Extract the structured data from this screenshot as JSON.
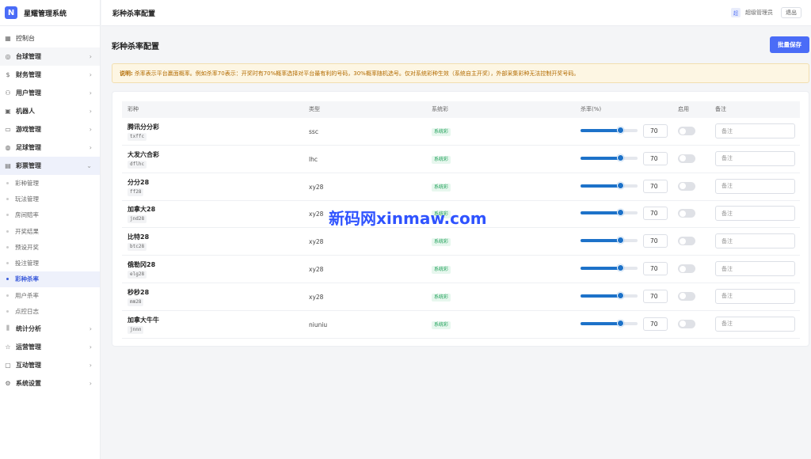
{
  "app": {
    "logo": "N",
    "name": "星耀管理系统"
  },
  "topbar": {
    "title": "彩种杀率配置",
    "user_badge": "超",
    "user_name": "超级管理员",
    "logout_label": "退出"
  },
  "sidebar": {
    "items": [
      {
        "label": "控制台",
        "icon": "dashboard-icon",
        "glyph": "▦",
        "bold": false,
        "chevron": ""
      },
      {
        "label": "台球管理",
        "icon": "billiards-icon",
        "glyph": "◎",
        "bold": true,
        "chevron": "›"
      },
      {
        "label": "财务管理",
        "icon": "dollar-icon",
        "glyph": "$",
        "bold": true,
        "chevron": "›"
      },
      {
        "label": "用户管理",
        "icon": "users-icon",
        "glyph": "⚇",
        "bold": true,
        "chevron": "›"
      },
      {
        "label": "机器人",
        "icon": "robot-icon",
        "glyph": "▣",
        "bold": true,
        "chevron": "›"
      },
      {
        "label": "游戏管理",
        "icon": "gamepad-icon",
        "glyph": "▭",
        "bold": true,
        "chevron": "›"
      },
      {
        "label": "足球管理",
        "icon": "football-icon",
        "glyph": "◍",
        "bold": true,
        "chevron": "›"
      },
      {
        "label": "彩票管理",
        "icon": "lottery-icon",
        "glyph": "▤",
        "bold": true,
        "chevron": "⌄"
      }
    ],
    "sub_items": [
      "彩种管理",
      "玩法管理",
      "房间赔率",
      "开奖结果",
      "预设开奖",
      "投注管理",
      "彩种杀率",
      "用户杀率",
      "点控日志"
    ],
    "active_sub": "彩种杀率",
    "items_after": [
      {
        "label": "统计分析",
        "icon": "bar-chart-icon",
        "glyph": "⫼",
        "bold": true,
        "chevron": "›"
      },
      {
        "label": "运营管理",
        "icon": "star-icon",
        "glyph": "☆",
        "bold": true,
        "chevron": "›"
      },
      {
        "label": "互动管理",
        "icon": "chat-icon",
        "glyph": "▢",
        "bold": true,
        "chevron": "›"
      },
      {
        "label": "系统设置",
        "icon": "gear-icon",
        "glyph": "⚙",
        "bold": true,
        "chevron": "›"
      }
    ]
  },
  "page": {
    "title": "彩种杀率配置",
    "save_label": "批量保存"
  },
  "notice": {
    "label": "说明:",
    "text": "杀率表示平台赢面概率。例如杀率70表示：开奖时有70%概率选择对平台最有利的号码，30%概率随机选号。仅对系统彩种生效（系统自主开奖），外部采集彩种无法控制开奖号码。"
  },
  "table": {
    "headers": {
      "name": "彩种",
      "type": "类型",
      "system": "系统彩",
      "rate": "杀率(%)",
      "enabled": "启用",
      "note": "备注"
    },
    "rows": [
      {
        "name": "腾讯分分彩",
        "code": "txffc",
        "type": "ssc",
        "system_tag": "系统彩",
        "rate": 70,
        "enabled": false,
        "note_placeholder": "备注"
      },
      {
        "name": "大发六合彩",
        "code": "dflhc",
        "type": "lhc",
        "system_tag": "系统彩",
        "rate": 70,
        "enabled": false,
        "note_placeholder": "备注"
      },
      {
        "name": "分分28",
        "code": "ff28",
        "type": "xy28",
        "system_tag": "系统彩",
        "rate": 70,
        "enabled": false,
        "note_placeholder": "备注"
      },
      {
        "name": "加拿大28",
        "code": "jnd28",
        "type": "xy28",
        "system_tag": "系统彩",
        "rate": 70,
        "enabled": false,
        "note_placeholder": "备注"
      },
      {
        "name": "比特28",
        "code": "btc28",
        "type": "xy28",
        "system_tag": "系统彩",
        "rate": 70,
        "enabled": false,
        "note_placeholder": "备注"
      },
      {
        "name": "俄勒冈28",
        "code": "elg28",
        "type": "xy28",
        "system_tag": "系统彩",
        "rate": 70,
        "enabled": false,
        "note_placeholder": "备注"
      },
      {
        "name": "秒秒28",
        "code": "mm28",
        "type": "xy28",
        "system_tag": "系统彩",
        "rate": 70,
        "enabled": false,
        "note_placeholder": "备注"
      },
      {
        "name": "加拿大牛牛",
        "code": "jnnn",
        "type": "niuniu",
        "system_tag": "系统彩",
        "rate": 70,
        "enabled": false,
        "note_placeholder": "备注"
      }
    ]
  },
  "watermark": "新码网xinmaw.com",
  "colors": {
    "primary": "#4a6cf7",
    "slider": "#1d72c9",
    "notice_text": "#b26b00",
    "notice_bg": "#fdf6e3",
    "tag_green": "#1a9e55"
  }
}
